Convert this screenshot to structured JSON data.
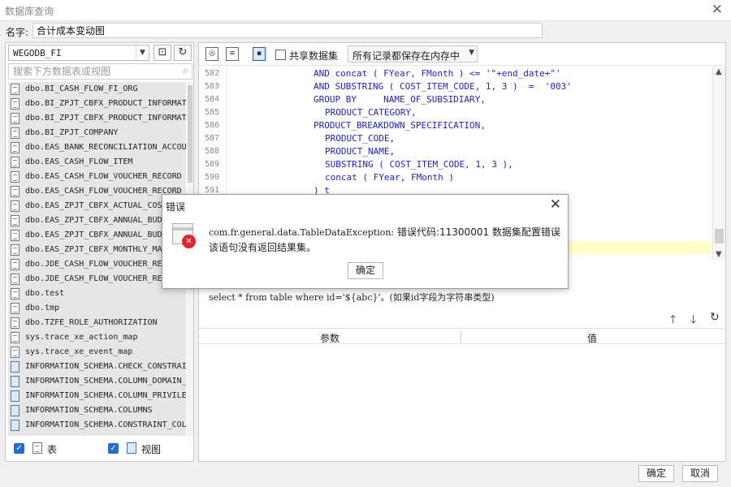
{
  "window": {
    "title": "数据库查询"
  },
  "name_row": {
    "label": "名字:",
    "value": "合计成本变动图"
  },
  "left": {
    "db_selected": "WEGODB_FI",
    "search_placeholder": "搜索下方数据表或视图",
    "items": [
      {
        "name": "dbo.BI_CASH_FLOW_FI_ORG",
        "kind": "table"
      },
      {
        "name": "dbo.BI_ZPJT_CBFX_PRODUCT_INFORMATI",
        "kind": "table"
      },
      {
        "name": "dbo.BI_ZPJT_CBFX_PRODUCT_INFORMATI",
        "kind": "table"
      },
      {
        "name": "dbo.BI_ZPJT_COMPANY",
        "kind": "table"
      },
      {
        "name": "dbo.EAS_BANK_RECONCILIATION_ACCOU",
        "kind": "table"
      },
      {
        "name": "dbo.EAS_CASH_FLOW_ITEM",
        "kind": "table"
      },
      {
        "name": "dbo.EAS_CASH_FLOW_VOUCHER_RECORD",
        "kind": "table"
      },
      {
        "name": "dbo.EAS_CASH_FLOW_VOUCHER_RECORD",
        "kind": "table"
      },
      {
        "name": "dbo.EAS_ZPJT_CBFX_ACTUAL_COST",
        "kind": "table"
      },
      {
        "name": "dbo.EAS_ZPJT_CBFX_ANNUAL_BUDG",
        "kind": "table"
      },
      {
        "name": "dbo.EAS_ZPJT_CBFX_ANNUAL_BUDG",
        "kind": "table"
      },
      {
        "name": "dbo.EAS_ZPJT_CBFX_MONTHLY_MA",
        "kind": "table"
      },
      {
        "name": "dbo.JDE_CASH_FLOW_VOUCHER_REC",
        "kind": "table"
      },
      {
        "name": "dbo.JDE_CASH_FLOW_VOUCHER_REC",
        "kind": "table"
      },
      {
        "name": "dbo.test",
        "kind": "table"
      },
      {
        "name": "dbo.tmp",
        "kind": "table"
      },
      {
        "name": "dbo.TZFE_ROLE_AUTHORIZATION",
        "kind": "table"
      },
      {
        "name": "sys.trace_xe_action_map",
        "kind": "table"
      },
      {
        "name": "sys.trace_xe_event_map",
        "kind": "table"
      },
      {
        "name": "INFORMATION_SCHEMA.CHECK_CONSTRAI",
        "kind": "view"
      },
      {
        "name": "INFORMATION_SCHEMA.COLUMN_DOMAIN_",
        "kind": "view"
      },
      {
        "name": "INFORMATION_SCHEMA.COLUMN_PRIVILE",
        "kind": "view"
      },
      {
        "name": "INFORMATION_SCHEMA.COLUMNS",
        "kind": "view"
      },
      {
        "name": "INFORMATION_SCHEMA.CONSTRAINT_COL",
        "kind": "view"
      }
    ],
    "check_table_label": "表",
    "check_view_label": "视图"
  },
  "toolbar": {
    "share_label": "共享数据集",
    "store_value": "所有记录都保存在内存中"
  },
  "code": {
    "lines": [
      {
        "n": "582",
        "t": "AND concat ( FYear, FMonth ) <= '\"+end_date+\"'",
        "indent": 15
      },
      {
        "n": "583",
        "t": "AND SUBSTRING ( COST_ITEM_CODE, 1, 3 )  =  '003'",
        "indent": 15
      },
      {
        "n": "584",
        "t": "GROUP BY     NAME_OF_SUBSIDIARY,",
        "indent": 15
      },
      {
        "n": "585",
        "t": "PRODUCT_CATEGORY,",
        "indent": 17
      },
      {
        "n": "586",
        "t": "PRODUCT_BREAKDOWN_SPECIFICATION,",
        "indent": 15
      },
      {
        "n": "587",
        "t": "PRODUCT_CODE,",
        "indent": 17
      },
      {
        "n": "588",
        "t": "PRODUCT_NAME,",
        "indent": 17
      },
      {
        "n": "589",
        "t": "SUBSTRING ( COST_ITEM_CODE, 1, 3 ),",
        "indent": 17
      },
      {
        "n": "590",
        "t": "concat ( FYear, FMonth )",
        "indent": 17
      },
      {
        "n": "591",
        "t": ") t",
        "indent": 15
      }
    ],
    "hint": "select * from table where id='${abc}'。(如果id字段为字符串类型)"
  },
  "params": {
    "col_param": "参数",
    "col_value": "值"
  },
  "buttons": {
    "ok": "确定",
    "cancel": "取消"
  },
  "dialog": {
    "title": "错误",
    "message_code": "com.fr.general.data.TableDataException:",
    "message_cn": " 错误代码:11300001 数据集配置错误",
    "message_line2": "该语句没有返回结果集。",
    "ok": "确定"
  },
  "colors": {
    "accent": "#1e6fd9",
    "error": "#e0262a",
    "highlight": "#ffffc8"
  }
}
